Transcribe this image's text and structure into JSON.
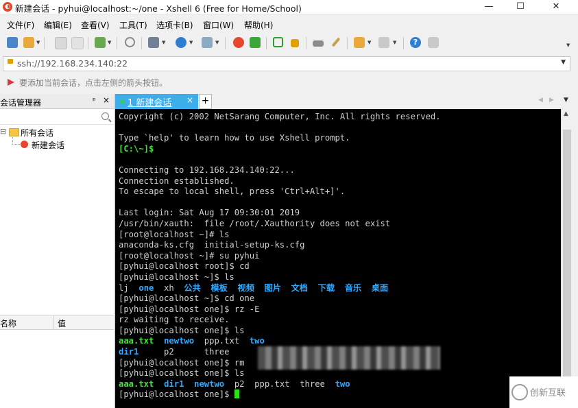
{
  "window": {
    "title": "新建会话 - pyhui@localhost:~/one - Xshell 6 (Free for Home/School)",
    "controls": [
      "—",
      "☐",
      "✕"
    ]
  },
  "menu": [
    "文件(F)",
    "编辑(E)",
    "查看(V)",
    "工具(T)",
    "选项卡(B)",
    "窗口(W)",
    "帮助(H)"
  ],
  "address": {
    "value": "ssh://192.168.234.140:22"
  },
  "hint": {
    "text": "要添加当前会话，点击左侧的箭头按钮。"
  },
  "session_panel": {
    "title": "会话管理器",
    "pin": "ᵖ",
    "close": "×",
    "tree_toggle": "⊟",
    "tree_root": "所有会话",
    "tree_child": "新建会话",
    "columns": [
      "名称",
      "值"
    ]
  },
  "tabs": {
    "active": "1 新建会话",
    "close": "×",
    "add": "+"
  },
  "terminal": {
    "lines": [
      [
        {
          "t": "Copyright (c) 2002 NetSarang Computer, Inc. All rights reserved.",
          "c": ""
        }
      ],
      [
        {
          "t": "",
          "c": ""
        }
      ],
      [
        {
          "t": "Type `help' to learn how to use Xshell prompt.",
          "c": ""
        }
      ],
      [
        {
          "t": "[C:\\~]$",
          "c": "green"
        }
      ],
      [
        {
          "t": "",
          "c": ""
        }
      ],
      [
        {
          "t": "Connecting to 192.168.234.140:22...",
          "c": ""
        }
      ],
      [
        {
          "t": "Connection established.",
          "c": ""
        }
      ],
      [
        {
          "t": "To escape to local shell, press 'Ctrl+Alt+]'.",
          "c": ""
        }
      ],
      [
        {
          "t": "",
          "c": ""
        }
      ],
      [
        {
          "t": "Last login: Sat Aug 17 09:30:01 2019",
          "c": ""
        }
      ],
      [
        {
          "t": "/usr/bin/xauth:  file /root/.Xauthority does not exist",
          "c": ""
        }
      ],
      [
        {
          "t": "[root@localhost ~]# ls",
          "c": ""
        }
      ],
      [
        {
          "t": "anaconda-ks.cfg  initial-setup-ks.cfg",
          "c": ""
        }
      ],
      [
        {
          "t": "[root@localhost ~]# su pyhui",
          "c": ""
        }
      ],
      [
        {
          "t": "[pyhui@localhost root]$ cd",
          "c": ""
        }
      ],
      [
        {
          "t": "[pyhui@localhost ~]$ ls",
          "c": ""
        }
      ],
      [
        {
          "t": "lj  ",
          "c": ""
        },
        {
          "t": "one",
          "c": "blue"
        },
        {
          "t": "  xh  ",
          "c": ""
        },
        {
          "t": "公共  模板  视频  图片  文档  下载  音乐  桌面",
          "c": "blue"
        }
      ],
      [
        {
          "t": "[pyhui@localhost ~]$ cd one",
          "c": ""
        }
      ],
      [
        {
          "t": "[pyhui@localhost one]$ rz -E",
          "c": ""
        }
      ],
      [
        {
          "t": "rz waiting to receive.",
          "c": ""
        }
      ],
      [
        {
          "t": "[pyhui@localhost one]$ ls",
          "c": ""
        }
      ],
      [
        {
          "t": "aaa.txt",
          "c": "green"
        },
        {
          "t": "  ",
          "c": ""
        },
        {
          "t": "newtwo",
          "c": "blue"
        },
        {
          "t": "  ppp.txt  ",
          "c": ""
        },
        {
          "t": "two",
          "c": "blue"
        }
      ],
      [
        {
          "t": "dir1",
          "c": "blue"
        },
        {
          "t": "     p2      three",
          "c": ""
        }
      ],
      [
        {
          "t": "[pyhui@localhost one]$ rm",
          "c": ""
        }
      ],
      [
        {
          "t": "[pyhui@localhost one]$ ls",
          "c": ""
        }
      ],
      [
        {
          "t": "aaa.txt",
          "c": "green"
        },
        {
          "t": "  ",
          "c": ""
        },
        {
          "t": "dir1",
          "c": "blue"
        },
        {
          "t": "  ",
          "c": ""
        },
        {
          "t": "newtwo",
          "c": "blue"
        },
        {
          "t": "  p2  ppp.txt  three  ",
          "c": ""
        },
        {
          "t": "two",
          "c": "blue"
        }
      ],
      [
        {
          "t": "[pyhui@localhost one]$ ",
          "c": ""
        }
      ]
    ]
  },
  "watermark": {
    "text": "创新互联"
  },
  "colors": {
    "tab_active": "#3daee9",
    "terminal_bg": "#000000",
    "prompt_green": "#48e03f",
    "dir_blue": "#33a9ff",
    "cursor": "#2de020"
  }
}
